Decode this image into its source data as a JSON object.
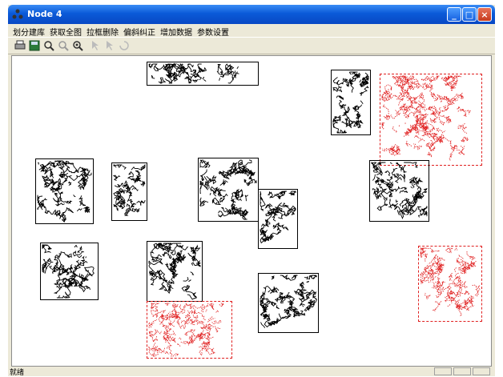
{
  "window": {
    "title": "Node 4"
  },
  "menu": [
    "划分建库",
    "获取全图",
    "拉框删除",
    "偏斜纠正",
    "增加数据",
    "参数设置"
  ],
  "toolbar": {
    "icons": [
      "print-icon",
      "save-icon",
      "zoom-in-icon",
      "zoom-out-icon",
      "zoom-fit-icon",
      "select-arrow-icon",
      "pan-arrow-icon",
      "rotate-icon"
    ]
  },
  "status": {
    "text": "就绪"
  },
  "colors": {
    "selected": "#e02020",
    "normal": "#000000",
    "accent": "#0a5ad8"
  },
  "tiles": [
    {
      "name": "tile-top-center",
      "state": "normal"
    },
    {
      "name": "tile-top-right-small",
      "state": "normal"
    },
    {
      "name": "tile-top-right-red",
      "state": "selected"
    },
    {
      "name": "tile-left-1",
      "state": "normal"
    },
    {
      "name": "tile-left-2",
      "state": "normal"
    },
    {
      "name": "tile-center",
      "state": "normal"
    },
    {
      "name": "tile-center-small",
      "state": "normal"
    },
    {
      "name": "tile-right-mid",
      "state": "normal"
    },
    {
      "name": "tile-left-lower",
      "state": "normal"
    },
    {
      "name": "tile-center-lower",
      "state": "normal"
    },
    {
      "name": "tile-center-lower-red",
      "state": "selected"
    },
    {
      "name": "tile-bottom-center",
      "state": "normal"
    },
    {
      "name": "tile-right-red",
      "state": "selected"
    }
  ]
}
